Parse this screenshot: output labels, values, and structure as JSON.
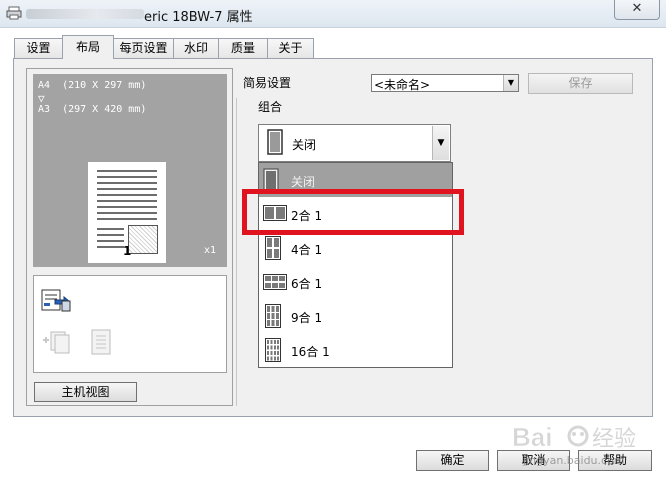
{
  "window": {
    "title": "eric 18BW-7 属性",
    "close_glyph": "✕"
  },
  "tabs": [
    {
      "label": "设置"
    },
    {
      "label": "布局"
    },
    {
      "label": "每页设置"
    },
    {
      "label": "水印"
    },
    {
      "label": "质量"
    },
    {
      "label": "关于"
    }
  ],
  "active_tab": "布局",
  "preview": {
    "paper_line_1": "A4  (210 X 297 mm)",
    "arrow": "▽",
    "paper_line_2": "A3  (297 X 420 mm)",
    "page_number": "1",
    "copies": "x1"
  },
  "host_view_button": "主机视图",
  "easy_settings": {
    "label": "简易设置",
    "value": "<未命名>",
    "save_button": "保存"
  },
  "combine": {
    "label": "组合",
    "current": "关闭",
    "options": [
      {
        "label": "关闭",
        "icon": "page-1up-icon"
      },
      {
        "label": "2合 1",
        "icon": "page-2up-icon"
      },
      {
        "label": "4合 1",
        "icon": "page-4up-icon"
      },
      {
        "label": "6合 1",
        "icon": "page-6up-icon"
      },
      {
        "label": "9合 1",
        "icon": "page-9up-icon"
      },
      {
        "label": "16合 1",
        "icon": "page-16up-icon"
      }
    ],
    "selected_index": 0,
    "highlighted_index": 1
  },
  "footer": {
    "ok": "确定",
    "cancel": "取消",
    "help": "帮助"
  },
  "watermark_text": "jingyan.baidu.com",
  "colors": {
    "highlight": "#e0141e",
    "selected_item_bg": "#a0a0a0",
    "preview_bg": "#a3a3a3"
  }
}
